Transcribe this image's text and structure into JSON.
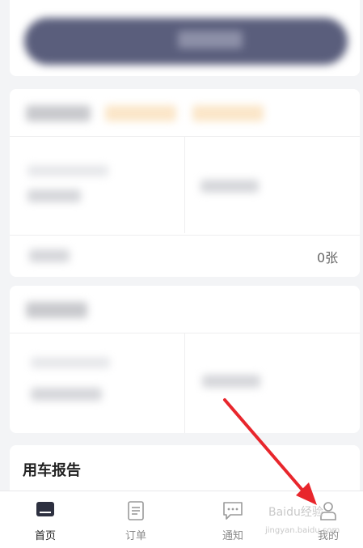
{
  "colors": {
    "accent": "#5a5e7c",
    "annotation_arrow": "#e8262c",
    "tag_bg": "#fbe6c8"
  },
  "partial_text": {
    "count_suffix": "0张"
  },
  "report_section": {
    "title": "用车报告"
  },
  "tabbar": {
    "items": [
      {
        "label": "首页",
        "icon": "home-card-icon",
        "active": true
      },
      {
        "label": "订单",
        "icon": "document-icon",
        "active": false
      },
      {
        "label": "通知",
        "icon": "chat-bubble-icon",
        "active": false
      },
      {
        "label": "我的",
        "icon": "user-icon",
        "active": false
      }
    ]
  },
  "watermark": {
    "text": "Baidu经验",
    "url": "jingyan.baidu.com"
  }
}
